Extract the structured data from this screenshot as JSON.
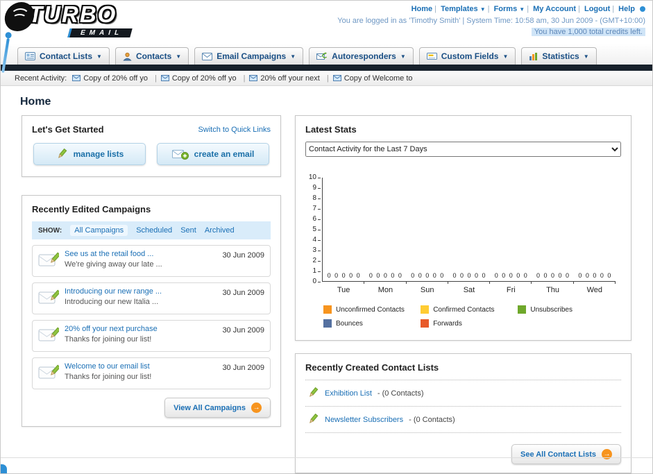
{
  "icons": {
    "dropdown_arrow": "▼",
    "arrow_right": "→"
  },
  "header": {
    "logo": {
      "title": "TURBO",
      "subtitle": "EMAIL"
    },
    "separator": "|",
    "nav_links": [
      "Home",
      "Templates",
      "Forms",
      "My Account",
      "Logout",
      "Help"
    ],
    "login_info": "You are logged in as 'Timothy Smith' | System Time: 10:58 am, 30 Jun 2009 - (GMT+10:00)",
    "credits_info": "You have 1,000 total credits left."
  },
  "nav_tabs": [
    "Contact Lists",
    "Contacts",
    "Email Campaigns",
    "Autoresponders",
    "Custom Fields",
    "Statistics"
  ],
  "recent_activity": {
    "label": "Recent Activity:",
    "items": [
      "Copy of 20% off yo",
      "Copy of 20% off yo",
      "20% off your next",
      "Copy of Welcome to"
    ]
  },
  "page": {
    "title": "Home"
  },
  "get_started": {
    "title": "Let's Get Started",
    "switch_link": "Switch to Quick Links",
    "buttons": [
      {
        "label": "manage lists"
      },
      {
        "label": "create an email"
      }
    ]
  },
  "campaigns": {
    "title": "Recently Edited Campaigns",
    "show_label": "SHOW:",
    "filters": [
      "All Campaigns",
      "Scheduled",
      "Sent",
      "Archived"
    ],
    "items": [
      {
        "title": "See us at the retail food ...",
        "subtitle": "We're giving away our late ...",
        "date": "30 Jun 2009"
      },
      {
        "title": "Introducing our new range ...",
        "subtitle": "Introducing our new Italia ...",
        "date": "30 Jun 2009"
      },
      {
        "title": "20% off your next purchase",
        "subtitle": "Thanks for joining our list!",
        "date": "30 Jun 2009"
      },
      {
        "title": "Welcome to our email list",
        "subtitle": "Thanks for joining our list!",
        "date": "30 Jun 2009"
      }
    ],
    "view_all_label": "View All Campaigns"
  },
  "stats": {
    "title": "Latest Stats",
    "dropdown_value": "Contact Activity for the Last 7 Days"
  },
  "chart_data": {
    "type": "bar",
    "title": "Contact Activity for the Last 7 Days",
    "categories": [
      "Tue",
      "Mon",
      "Sun",
      "Sat",
      "Fri",
      "Thu",
      "Wed"
    ],
    "series": [
      {
        "name": "Unconfirmed Contacts",
        "color": "#F7941E",
        "values": [
          0,
          0,
          0,
          0,
          0,
          0,
          0
        ]
      },
      {
        "name": "Confirmed Contacts",
        "color": "#FFCC33",
        "values": [
          0,
          0,
          0,
          0,
          0,
          0,
          0
        ]
      },
      {
        "name": "Unsubscribes",
        "color": "#6FA82B",
        "values": [
          0,
          0,
          0,
          0,
          0,
          0,
          0
        ]
      },
      {
        "name": "Bounces",
        "color": "#5470A0",
        "values": [
          0,
          0,
          0,
          0,
          0,
          0,
          0
        ]
      },
      {
        "name": "Forwards",
        "color": "#E85A2A",
        "values": [
          0,
          0,
          0,
          0,
          0,
          0,
          0
        ]
      }
    ],
    "ylim": [
      0,
      10
    ],
    "y_tick_step": 1,
    "grid": false,
    "legend_position": "bottom",
    "value_labels_shown": true
  },
  "contact_lists": {
    "title": "Recently Created Contact Lists",
    "items": [
      {
        "name": "Exhibition List",
        "detail": "- (0 Contacts)"
      },
      {
        "name": "Newsletter Subscribers",
        "detail": "- (0 Contacts)"
      }
    ],
    "see_all_label": "See All Contact Lists"
  }
}
